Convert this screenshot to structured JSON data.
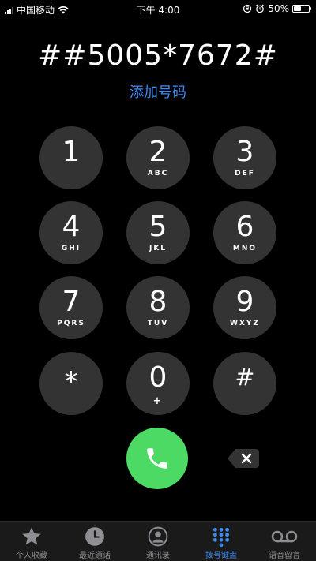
{
  "status_bar": {
    "carrier": "中国移动",
    "time": "下午 4:00",
    "battery_percent": "50%",
    "battery_level": 0.5,
    "icons": [
      "signal-icon",
      "wifi-icon",
      "rotation-lock-icon",
      "alarm-icon",
      "battery-icon"
    ]
  },
  "dialer": {
    "dialed_number": "##5005*7672#",
    "add_number": "添加号码"
  },
  "keypad": [
    {
      "digit": "1",
      "letters": ""
    },
    {
      "digit": "2",
      "letters": "ABC"
    },
    {
      "digit": "3",
      "letters": "DEF"
    },
    {
      "digit": "4",
      "letters": "GHI"
    },
    {
      "digit": "5",
      "letters": "JKL"
    },
    {
      "digit": "6",
      "letters": "MNO"
    },
    {
      "digit": "7",
      "letters": "PQRS"
    },
    {
      "digit": "8",
      "letters": "TUV"
    },
    {
      "digit": "9",
      "letters": "WXYZ"
    },
    {
      "digit": "*",
      "letters": ""
    },
    {
      "digit": "0",
      "letters": "+"
    },
    {
      "digit": "#",
      "letters": ""
    }
  ],
  "tabs": [
    {
      "label": "个人收藏",
      "icon": "star-icon",
      "active": false
    },
    {
      "label": "最近通话",
      "icon": "clock-icon",
      "active": false
    },
    {
      "label": "通讯录",
      "icon": "contact-icon",
      "active": false
    },
    {
      "label": "拨号键盘",
      "icon": "keypad-icon",
      "active": true
    },
    {
      "label": "语音留言",
      "icon": "voicemail-icon",
      "active": false
    }
  ],
  "colors": {
    "accent": "#3d8bf5",
    "call_green": "#4cd964",
    "key_gray": "#333333",
    "background": "#000000"
  }
}
